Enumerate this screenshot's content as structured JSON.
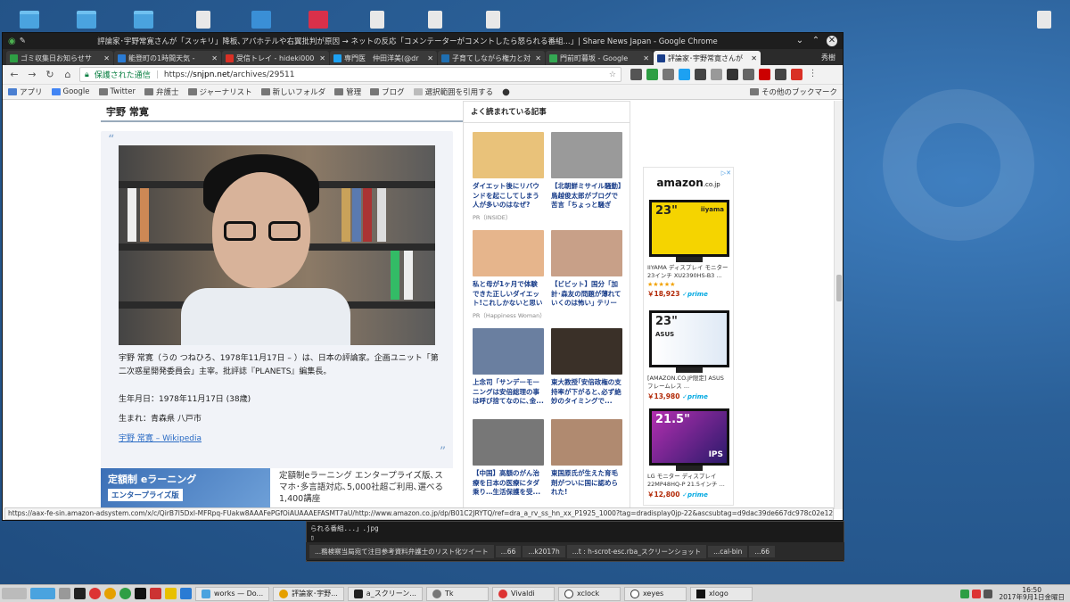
{
  "window": {
    "title": "評論家･宇野常寛さんが「スッキリ」降板､アパホテルや右翼批判が原因 → ネットの反応「コメンテーターがコメントしたら怒られる番組...」| Share News Japan - Google Chrome"
  },
  "tabs": [
    {
      "label": "ゴミ収集日お知らせサ",
      "color": "#2e9e44"
    },
    {
      "label": "能登町の1時間天気 - ",
      "color": "#2a7bd4"
    },
    {
      "label": "受信トレイ - hideki000",
      "color": "#d93025"
    },
    {
      "label": "専門医　仲田洋美(@dr",
      "color": "#1da1f2"
    },
    {
      "label": "子育てしながら権力と対",
      "color": "#1f6fb2"
    },
    {
      "label": "門前町暮坂 - Google",
      "color": "#34a853"
    },
    {
      "label": "評論家･宇野常寛さんが",
      "color": "#1a3e8a",
      "active": true
    }
  ],
  "profile": "秀樹",
  "address": {
    "secure_label": "保護された通信",
    "url_prefix": "https://",
    "url_host": "snjpn.net",
    "url_path": "/archives/29511"
  },
  "bookmarks": [
    "アプリ",
    "Google",
    "Twitter",
    "弁護士",
    "ジャーナリスト",
    "新しいフォルダ",
    "管理",
    "ブログ",
    "選択範囲を引用する",
    "その他のブックマーク"
  ],
  "article": {
    "heading": "宇野 常寛",
    "open_quote": "“",
    "close_quote": "”",
    "bio": "宇野 常寛（うの つねひろ、1978年11月17日 – ）は、日本の評論家。企画ユニット「第二次惑星開発委員会」主宰。批評誌『PLANETS』編集長。",
    "birthdate": "生年月日：1978年11月17日 (38歳)",
    "birthplace": "生まれ：青森県 八戸市",
    "wiki_link": "宇野 常寛 – Wikipedia"
  },
  "ad": {
    "image_title": "定額制 eラーニング",
    "image_sub": "エンタープライズ版",
    "text": "定額制eラーニング エンタープライズ版､スマホ･多言語対応､5,000社超ご利用､選べる1,400講座"
  },
  "popular": {
    "title": "よく読まれている記事",
    "items": [
      {
        "title": "ダイエット後にリバウンドを起こしてしまう人が多いのはなぜ?",
        "pr": "PR（INSIDE）",
        "color": "#e9c27a"
      },
      {
        "title": "【北朝鮮ミサイル騒動】鳥越俊太郎がブログで苦言「ちょっと騒ぎ過...",
        "pr": "",
        "color": "#9a9a9a"
      },
      {
        "title": "私と母が1ヶ月で体験できた正しいダイエット!これしかないと思いま...",
        "pr": "PR（Happiness Woman）",
        "color": "#e6b58c"
      },
      {
        "title": "【ビビット】国分「加計･森友の問題が薄れていくのは怖い｣ テリー｢...",
        "pr": "",
        "color": "#c8a088"
      },
      {
        "title": "上念司「サンデーモーニングは安倍総理の事は呼び捨てなのに､金...",
        "pr": "",
        "color": "#6a7fa0"
      },
      {
        "title": "東大教授｢安倍政権の支持率が下がると､必ず絶妙のタイミングで...",
        "pr": "",
        "color": "#3a3028"
      },
      {
        "title": "【中国】高額のがん治療を日本の医療にタダ乗り…生活保護を受...",
        "pr": "",
        "color": "#777777"
      },
      {
        "title": "東国原氏が生えた育毛剤がついに国に認められた!",
        "pr": "",
        "color": "#b08a70"
      }
    ]
  },
  "amazon": {
    "logo": "amazon",
    "logo_suffix": ".co.jp",
    "adchoice": "▷✕",
    "products": [
      {
        "label": "23\"",
        "brand": "iiyama",
        "name": "IIYAMA ディスプレイ モニター 23インチ XU2390HS-B3 ...",
        "stars": "★★★★★",
        "price": "￥18,923",
        "prime": "✓prime"
      },
      {
        "label": "23\"",
        "brand": "ASUS",
        "name": "[AMAZON.CO.JP限定] ASUS フレームレス ...",
        "stars": "",
        "price": "￥13,980",
        "prime": "✓prime"
      },
      {
        "label": "21.5\"",
        "brand": "IPS",
        "name": "LG モニター ディスプレイ 22MP48HQ-P 21.5インチ ...",
        "stars": "",
        "price": "￥12,800",
        "prime": "✓prime"
      }
    ]
  },
  "status_url": "https://aax-fe-sin.amazon-adsystem.com/x/c/QirB7l5Dxl-MFRpq-FUakw8AAAFePGfOiAUAAAEFASMT7aU/http://www.amazon.co.jp/dp/B01C2JRYTQ/ref=dra_a_rv_ss_hn_xx_P1925_1000?tag=dradisplay0jp-22&ascsubtag=d9dac39de667dc978c02e12d...",
  "terminal": {
    "line1": "られる番組...」.jpg",
    "tabs": [
      "...務検察当局宛て注目参考資料弁護士のリスト化ツイート",
      "...66",
      "...k2017h",
      "...t : h-scrot-esc.rba_スクリーンショット",
      "...cal-bin",
      "...66"
    ]
  },
  "taskbar": {
    "items": [
      "works — Do...",
      "評論家･宇野...",
      "a_スクリーン...",
      "Tk",
      "Vivaldi",
      "xclock",
      "xeyes",
      "xlogo"
    ],
    "time": "16:50",
    "date": "2017年9月1日金曜日"
  }
}
